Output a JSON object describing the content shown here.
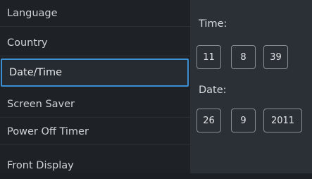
{
  "menu": {
    "items": [
      {
        "label": "Language"
      },
      {
        "label": "Country"
      },
      {
        "label": "Date/Time",
        "selected": true
      },
      {
        "label": "Screen Saver"
      },
      {
        "label": "Power Off Timer"
      },
      {
        "label": "Front Display"
      }
    ]
  },
  "time": {
    "label": "Time:",
    "hour": "11",
    "minute": "8",
    "second": "39"
  },
  "date": {
    "label": "Date:",
    "day": "26",
    "month": "9",
    "year": "2011"
  },
  "colors": {
    "background": "#1e2227",
    "panel": "#2b3036",
    "selection_border": "#3b8fd0"
  }
}
